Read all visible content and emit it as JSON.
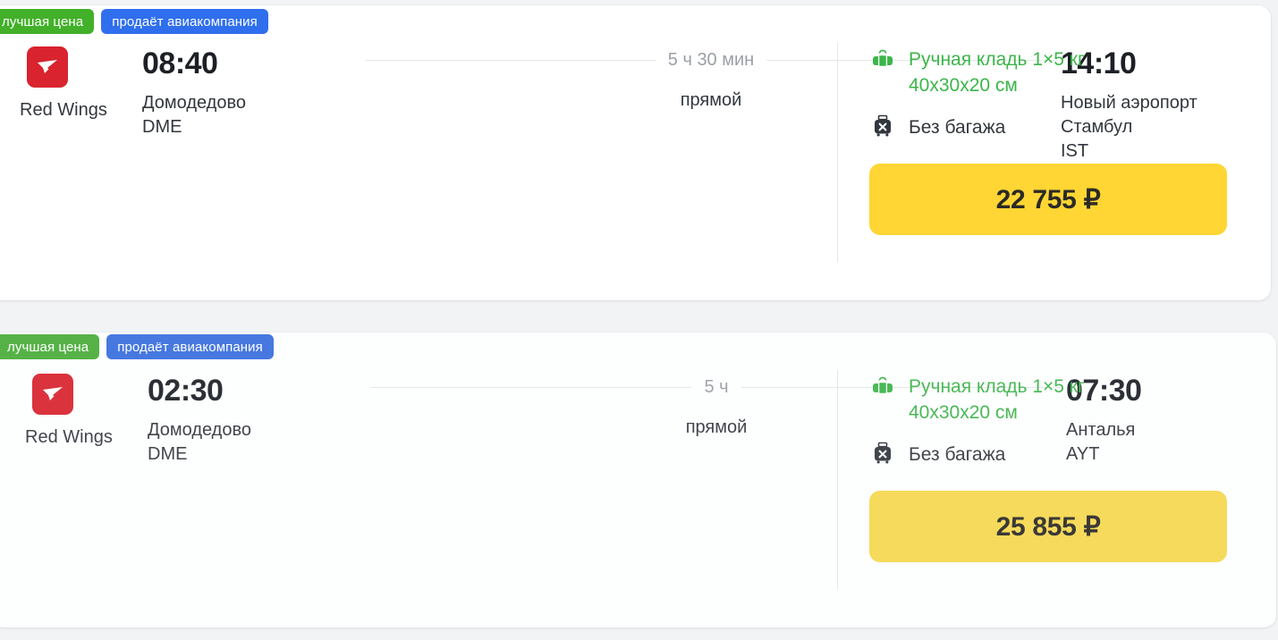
{
  "flights": [
    {
      "badges": [
        {
          "label": "лучшая цена",
          "color": "#43b02a",
          "name": "best-price"
        },
        {
          "label": "продаёт авиакомпания",
          "color": "#2f6fed",
          "name": "sold-by-airline"
        }
      ],
      "airline": {
        "name": "Red Wings",
        "logo_icon": "red-wings-logo",
        "logo_color": "#d9232e"
      },
      "departure": {
        "time": "08:40",
        "airport": "Домодедово",
        "code": "DME"
      },
      "arrival": {
        "time": "14:10",
        "airport": "Новый аэропорт Стамбул",
        "code": "IST"
      },
      "duration": "5 ч 30 мин",
      "stops": "прямой",
      "baggage": {
        "carry_on_icon": "carry-on-bag-icon",
        "carry_on_line1": "Ручная кладь 1×5 кг",
        "carry_on_line2": "40x30x20 см",
        "carry_on_color": "#3cb54a",
        "checked_icon": "no-checked-baggage-icon",
        "checked_label": "Без багажа"
      },
      "price": {
        "label": "22 755 ₽",
        "button_color": "#ffd633"
      }
    },
    {
      "badges": [
        {
          "label": "лучшая цена",
          "color": "#56b247",
          "name": "best-price"
        },
        {
          "label": "продаёт авиакомпания",
          "color": "#4678e0",
          "name": "sold-by-airline"
        }
      ],
      "airline": {
        "name": "Red Wings",
        "logo_icon": "red-wings-logo",
        "logo_color": "#d9232e"
      },
      "departure": {
        "time": "02:30",
        "airport": "Домодедово",
        "code": "DME"
      },
      "arrival": {
        "time": "07:30",
        "airport": "Анталья",
        "code": "AYT"
      },
      "duration": "5 ч",
      "stops": "прямой",
      "baggage": {
        "carry_on_icon": "carry-on-bag-icon",
        "carry_on_line1": "Ручная кладь 1×5 кг",
        "carry_on_line2": "40x30x20 см",
        "carry_on_color": "#3cb54a",
        "checked_icon": "no-checked-baggage-icon",
        "checked_label": "Без багажа"
      },
      "price": {
        "label": "25 855 ₽",
        "button_color": "#f7d84f"
      }
    }
  ]
}
